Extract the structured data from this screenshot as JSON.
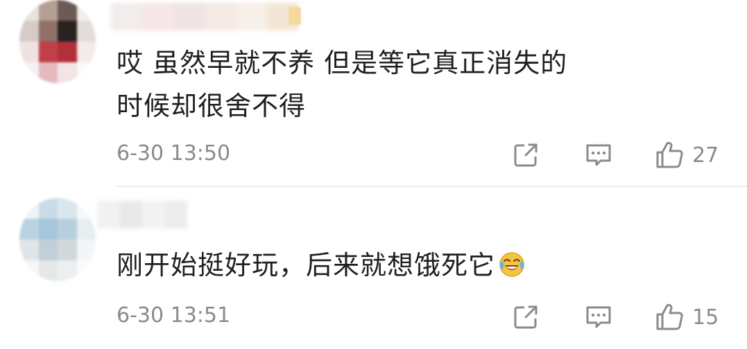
{
  "comments": [
    {
      "text_line1": "哎 虽然早就不养 但是等它真正消失的",
      "text_line2": "时候却很舍不得",
      "timestamp": "6-30 13:50",
      "like_count": "27"
    },
    {
      "text": "刚开始挺好玩，后来就想饿死它",
      "timestamp": "6-30 13:51",
      "like_count": "15"
    }
  ],
  "icons": {
    "share": "share-icon",
    "reply": "comment-icon",
    "like": "thumbs-up-icon",
    "emoji": "laughing-crying-emoji"
  },
  "colors": {
    "text": "#1f1f1f",
    "meta": "#8a8a8a",
    "divider": "#ececec"
  }
}
